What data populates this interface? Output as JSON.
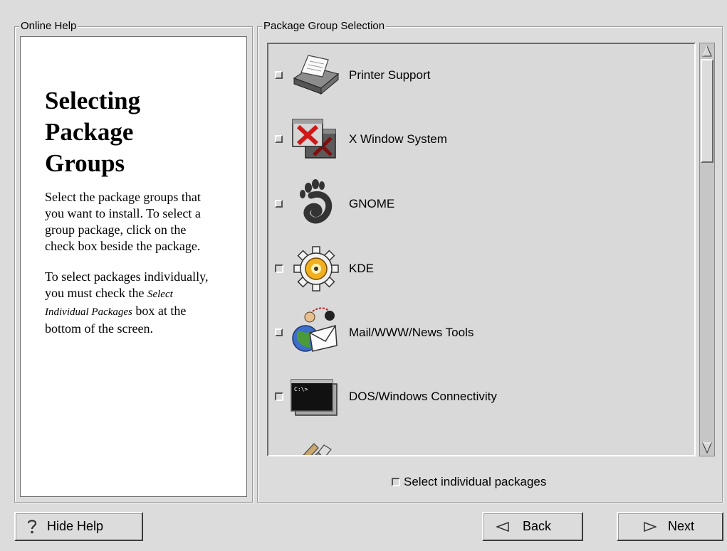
{
  "help": {
    "frame_label": "Online Help",
    "title_lines": [
      "Selecting",
      "Package",
      "Groups"
    ],
    "para1": "Select the package groups that you want to install. To select a group package, click on the check box beside the package.",
    "para2_prefix": "To select packages individually, you must check the ",
    "para2_em": "Select Individual Packages",
    "para2_suffix": " box at the bottom of the screen."
  },
  "packages": {
    "frame_label": "Package Group Selection",
    "items": [
      {
        "label": "Printer Support",
        "checked": false,
        "icon": "printer-icon"
      },
      {
        "label": "X Window System",
        "checked": false,
        "icon": "x-window-icon"
      },
      {
        "label": "GNOME",
        "checked": false,
        "icon": "gnome-foot-icon"
      },
      {
        "label": "KDE",
        "checked": false,
        "icon": "kde-gear-icon"
      },
      {
        "label": "Mail/WWW/News Tools",
        "checked": false,
        "icon": "mail-globe-icon"
      },
      {
        "label": "DOS/Windows Connectivity",
        "checked": false,
        "icon": "terminal-icon"
      },
      {
        "label": "",
        "checked": false,
        "icon": "tools-icon"
      }
    ],
    "select_individual_label": "Select individual packages",
    "select_individual_checked": false
  },
  "buttons": {
    "hide_help": "Hide Help",
    "back": "Back",
    "next": "Next"
  },
  "icons": {
    "hide_help": "question-mark-icon",
    "back": "left-triangle-icon",
    "next": "right-triangle-icon",
    "scroll_up": "scroll-up-arrow-icon",
    "scroll_down": "scroll-down-arrow-icon"
  },
  "colors": {
    "background": "#dcdcdc",
    "help_pane": "#ffffff",
    "list_bg": "#d9d9d9"
  }
}
